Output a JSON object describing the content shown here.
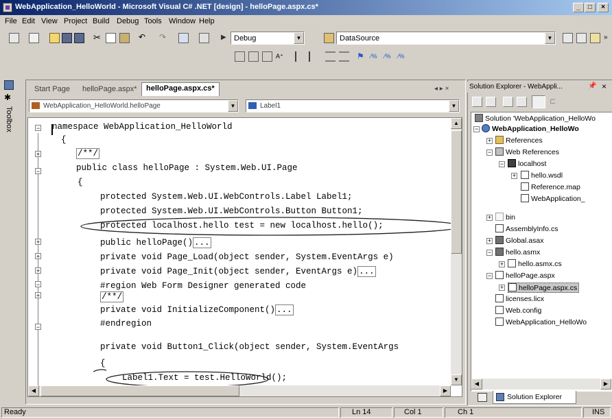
{
  "window": {
    "title": "WebApplication_HelloWorld - Microsoft Visual C# .NET [design] - helloPage.aspx.cs*"
  },
  "menu": [
    "File",
    "Edit",
    "View",
    "Project",
    "Build",
    "Debug",
    "Tools",
    "Window",
    "Help"
  ],
  "toolbar": {
    "config": "Debug",
    "datasource": "DataSource"
  },
  "toolbox": {
    "label": "Toolbox"
  },
  "tabs": [
    "Start Page",
    "helloPage.aspx*",
    "helloPage.aspx.cs*"
  ],
  "tab_nav": "◂ ▸ ×",
  "editor": {
    "class_combo": "WebApplication_HelloWorld.helloPage",
    "member_combo": "Label1",
    "lines": [
      "namespace WebApplication_HelloWorld",
      "{",
      "/**/",
      "public class helloPage : System.Web.UI.Page",
      "{",
      "protected System.Web.UI.WebControls.Label Label1;",
      "protected System.Web.UI.WebControls.Button Button1;",
      "protected localhost.hello test = new localhost.hello();",
      "public helloPage()",
      "private void Page_Load(object sender, System.EventArgs e)",
      "private void Page_Init(object sender, EventArgs e)",
      "#region Web Form Designer generated code",
      "/**/",
      "private void InitializeComponent()",
      "#endregion",
      "private void Button1_Click(object sender, System.EventArgs",
      "{",
      "Label1.Text = test.HelloWorld();",
      "}"
    ],
    "ellipsis": "..."
  },
  "solution_explorer": {
    "title": "Solution Explorer - WebAppli...",
    "items": [
      "Solution 'WebApplication_HelloWo",
      "WebApplication_HelloWo",
      "References",
      "Web References",
      "localhost",
      "hello.wsdl",
      "Reference.map",
      "WebApplication_",
      "bin",
      "AssemblyInfo.cs",
      "Global.asax",
      "hello.asmx",
      "hello.asmx.cs",
      "helloPage.aspx",
      "helloPage.aspx.cs",
      "licenses.licx",
      "Web.config",
      "WebApplication_HelloWo"
    ],
    "bottom_tab": "Solution Explorer"
  },
  "status": {
    "text": "Ready",
    "ln": "Ln 14",
    "col": "Col 1",
    "ch": "Ch 1",
    "ins": "INS"
  }
}
